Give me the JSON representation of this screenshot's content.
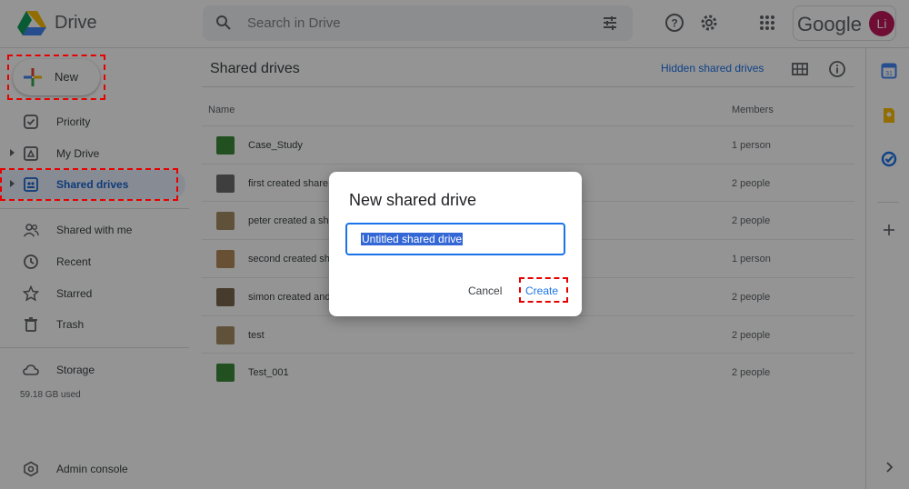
{
  "header": {
    "app_name": "Drive",
    "search_placeholder": "Search in Drive",
    "google_word": "Google",
    "avatar_initials": "Li"
  },
  "sidebar": {
    "new_label": "New",
    "items": [
      {
        "label": "Priority",
        "icon": "priority-icon"
      },
      {
        "label": "My Drive",
        "icon": "my-drive-icon"
      },
      {
        "label": "Shared drives",
        "icon": "shared-drives-icon",
        "active": true
      },
      {
        "label": "Shared with me",
        "icon": "people-icon"
      },
      {
        "label": "Recent",
        "icon": "clock-icon"
      },
      {
        "label": "Starred",
        "icon": "star-icon"
      },
      {
        "label": "Trash",
        "icon": "trash-icon"
      },
      {
        "label": "Storage",
        "icon": "cloud-icon"
      },
      {
        "label": "Admin console",
        "icon": "admin-icon"
      }
    ],
    "storage_used": "59.18 GB used"
  },
  "main": {
    "title": "Shared drives",
    "hidden_link": "Hidden shared drives",
    "col_name": "Name",
    "col_members": "Members",
    "rows": [
      {
        "name": "Case_Study",
        "members": "1 person",
        "thumb_color": "#3c8a3a"
      },
      {
        "name": "first created share",
        "members": "2 people",
        "thumb_color": "#6b6b6b"
      },
      {
        "name": "peter created a sh",
        "members": "2 people",
        "thumb_color": "#a58c66"
      },
      {
        "name": "second created sh",
        "members": "1 person",
        "thumb_color": "#b38a5a"
      },
      {
        "name": "simon created and",
        "members": "2 people",
        "thumb_color": "#7a6650"
      },
      {
        "name": "test",
        "members": "2 people",
        "thumb_color": "#a58c66"
      },
      {
        "name": "Test_001",
        "members": "2 people",
        "thumb_color": "#3c8a3a"
      }
    ]
  },
  "dialog": {
    "title": "New shared drive",
    "input_value": "Untitled shared drive",
    "cancel_label": "Cancel",
    "create_label": "Create"
  },
  "colors": {
    "accent": "#1a73e8",
    "highlight_dash": "#e60000",
    "active_bg": "#e8f0fe"
  }
}
